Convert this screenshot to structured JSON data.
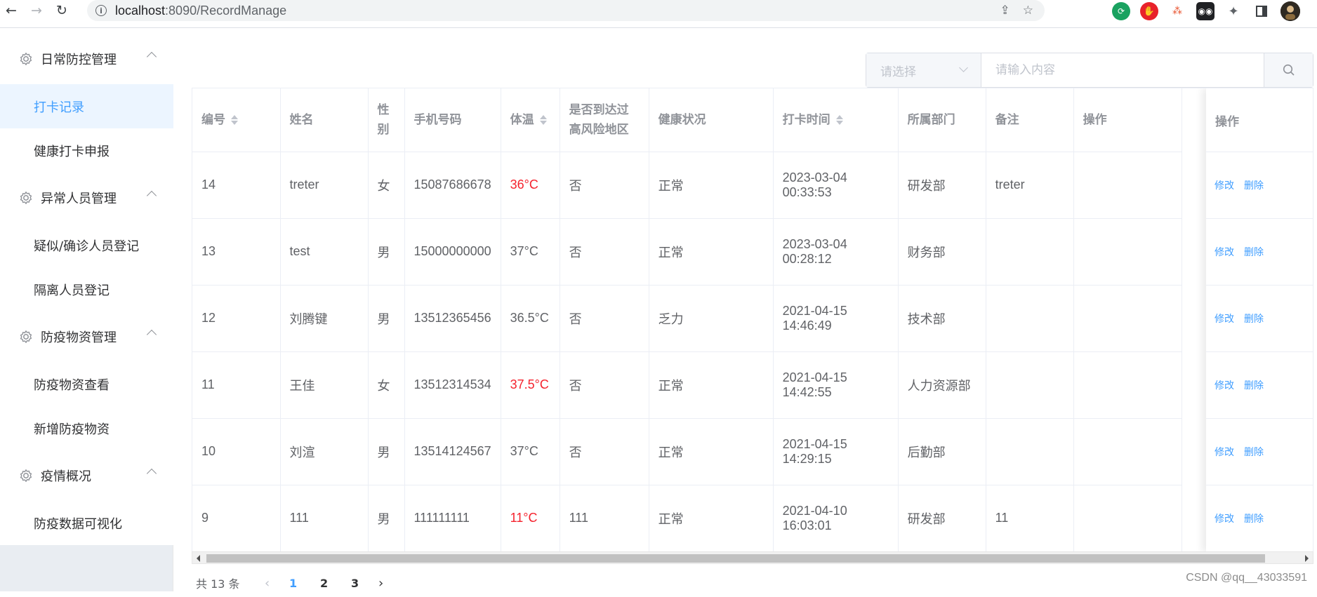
{
  "browser": {
    "url_host": "localhost",
    "url_rest": ":8090/RecordManage"
  },
  "sidebar": {
    "groups": [
      {
        "title": "日常防控管理",
        "items": [
          "打卡记录",
          "健康打卡申报"
        ]
      },
      {
        "title": "异常人员管理",
        "items": [
          "疑似/确诊人员登记",
          "隔离人员登记"
        ]
      },
      {
        "title": "防疫物资管理",
        "items": [
          "防疫物资查看",
          "新增防疫物资"
        ]
      },
      {
        "title": "疫情概况",
        "items": [
          "防疫数据可视化"
        ]
      }
    ],
    "active_item": "打卡记录"
  },
  "search": {
    "select_placeholder": "请选择",
    "input_placeholder": "请输入内容"
  },
  "table": {
    "columns": [
      "编号",
      "姓名",
      "性别",
      "手机号码",
      "体温",
      "是否到达过高风险地区",
      "健康状况",
      "打卡时间",
      "所属部门",
      "备注",
      "操作"
    ],
    "rows": [
      {
        "id": "14",
        "name": "treter",
        "gender": "女",
        "phone": "15087686678",
        "temp": "36°C",
        "hot": true,
        "risk": "否",
        "health": "正常",
        "time": "2023-03-04 00:33:53",
        "dept": "研发部",
        "note": "treter"
      },
      {
        "id": "13",
        "name": "test",
        "gender": "男",
        "phone": "15000000000",
        "temp": "37°C",
        "hot": false,
        "risk": "否",
        "health": "正常",
        "time": "2023-03-04 00:28:12",
        "dept": "财务部",
        "note": ""
      },
      {
        "id": "12",
        "name": "刘腾键",
        "gender": "男",
        "phone": "13512365456",
        "temp": "36.5°C",
        "hot": false,
        "risk": "否",
        "health": "乏力",
        "time": "2021-04-15 14:46:49",
        "dept": "技术部",
        "note": ""
      },
      {
        "id": "11",
        "name": "王佳",
        "gender": "女",
        "phone": "13512314534",
        "temp": "37.5°C",
        "hot": true,
        "risk": "否",
        "health": "正常",
        "time": "2021-04-15 14:42:55",
        "dept": "人力资源部",
        "note": ""
      },
      {
        "id": "10",
        "name": "刘渲",
        "gender": "男",
        "phone": "13514124567",
        "temp": "37°C",
        "hot": false,
        "risk": "否",
        "health": "正常",
        "time": "2021-04-15 14:29:15",
        "dept": "后勤部",
        "note": ""
      },
      {
        "id": "9",
        "name": "111",
        "gender": "男",
        "phone": "111111111",
        "temp": "11°C",
        "hot": true,
        "risk": "111",
        "health": "正常",
        "time": "2021-04-10 16:03:01",
        "dept": "研发部",
        "note": "11"
      }
    ],
    "edit_label": "修改",
    "delete_label": "删除"
  },
  "pager": {
    "total_text": "共 13 条",
    "pages": [
      "1",
      "2",
      "3"
    ],
    "current": "1"
  },
  "watermark": "CSDN @qq__43033591",
  "colors": {
    "accent": "#409eff",
    "hot_temp": "#f5222d",
    "active_bg": "#ecf5ff"
  }
}
